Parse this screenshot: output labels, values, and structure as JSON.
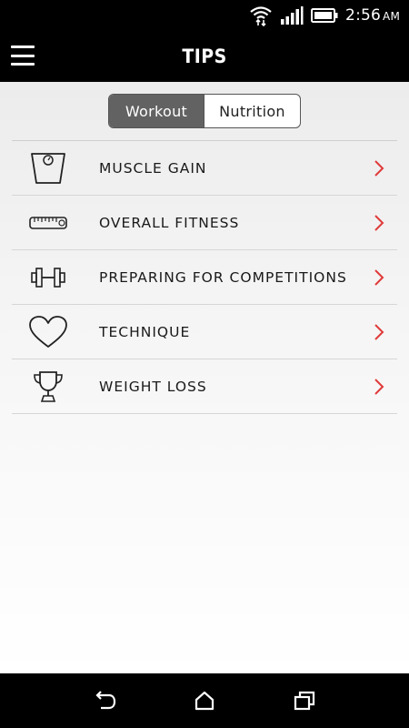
{
  "status_bar": {
    "time": "2:56",
    "ampm": "AM"
  },
  "header": {
    "title": "TIPS"
  },
  "segmented_control": {
    "options": [
      "Workout",
      "Nutrition"
    ],
    "selected": "Workout"
  },
  "tips": [
    {
      "label": "MUSCLE GAIN",
      "icon": "scale-icon"
    },
    {
      "label": "OVERALL FITNESS",
      "icon": "tape-measure-icon"
    },
    {
      "label": "PREPARING FOR COMPETITIONS",
      "icon": "dumbbell-icon"
    },
    {
      "label": "TECHNIQUE",
      "icon": "heart-icon"
    },
    {
      "label": "WEIGHT LOSS",
      "icon": "trophy-icon"
    }
  ],
  "colors": {
    "accent": "#e03a3a",
    "bar_background": "#000000",
    "segment_active": "#626262"
  }
}
